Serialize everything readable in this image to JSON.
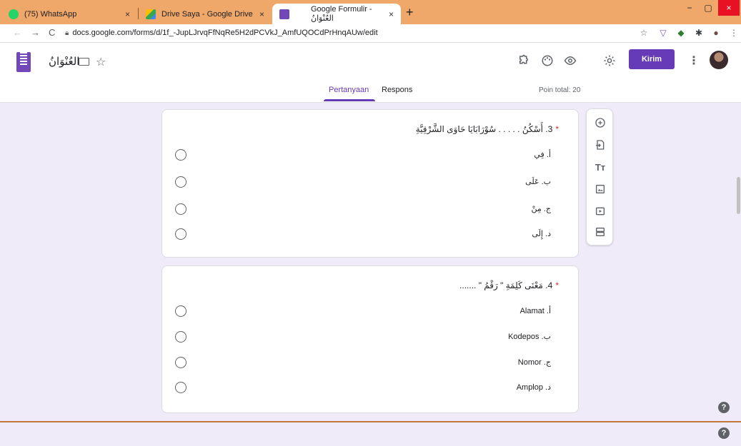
{
  "browser": {
    "tabs": [
      {
        "title": "(75) WhatsApp",
        "close": "×",
        "favicon_color": "#25d366"
      },
      {
        "title": "Drive Saya - Google Drive",
        "close": "×",
        "favicon_color": "#fbbc04"
      },
      {
        "title": "Google Formulir - العُنْوَانُ",
        "close": "×",
        "favicon_color": "#7248b9"
      }
    ],
    "new_tab": "+",
    "window_controls": {
      "minimize": "−",
      "maximize": "▢",
      "close": "×"
    },
    "nav": {
      "back": "←",
      "forward": "→",
      "reload": "C"
    },
    "url": "docs.google.com/forms/d/1f_-JupLJrvqFfNqRe5H2dPCVkJ_AmfUQOCdPrHnqAUw/edit",
    "extensions": [
      "☆",
      "▽",
      "◆",
      "✱",
      "●",
      "⋮"
    ]
  },
  "forms": {
    "doc_title": "العُنْوَانُ",
    "header_icons": [
      "puzzle-icon",
      "palette-icon",
      "eye-icon",
      "settings-icon"
    ],
    "send_label": "Kirim",
    "more": "⋮",
    "tabs": {
      "questions": "Pertanyaan",
      "responses": "Respons"
    },
    "points_total": "Poin total: 20",
    "accent_color": "#673ab7"
  },
  "questions": [
    {
      "title": "3. أَسْكُنُ . . . . . سُوْرَابَايَا حَاوَى الشَّرْقِيَّةِ",
      "required_mark": "*",
      "options": [
        "أ. فِي",
        "ب. عَلَى",
        "ج. مِنْ",
        "د. إِلَى"
      ]
    },
    {
      "title": "4. مَعْنَى كَلِمَةِ \" رَقْمُ \" .......",
      "required_mark": "*",
      "options": [
        "أ. Alamat",
        "ب. Kodepos",
        "ج. Nomor",
        "د. Amplop"
      ]
    }
  ],
  "side_toolbar": [
    "add-question-icon",
    "import-questions-icon",
    "add-title-icon",
    "add-image-icon",
    "add-video-icon",
    "add-section-icon"
  ],
  "help": "?"
}
